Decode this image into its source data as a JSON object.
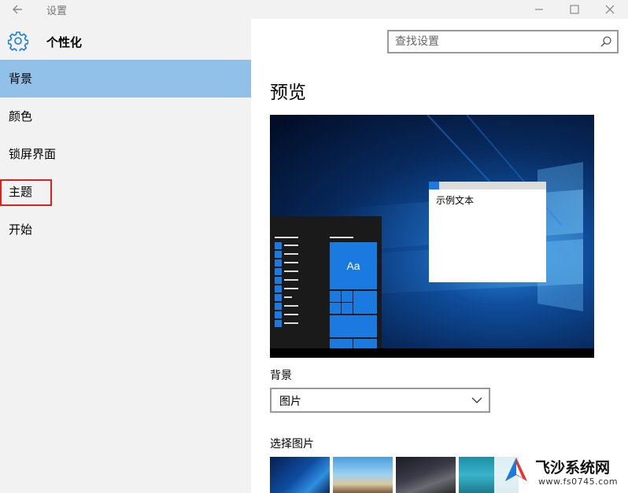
{
  "window": {
    "title": "设置",
    "back_icon": "back-arrow-icon",
    "controls": [
      "minimize-icon",
      "maximize-icon",
      "close-icon"
    ]
  },
  "header": {
    "icon": "gear-icon",
    "title": "个性化"
  },
  "search": {
    "placeholder": "查找设置",
    "icon": "search-icon"
  },
  "sidebar": {
    "items": [
      {
        "label": "背景",
        "active": true
      },
      {
        "label": "颜色"
      },
      {
        "label": "锁屏界面"
      },
      {
        "label": "主题",
        "highlighted": true
      },
      {
        "label": "开始"
      }
    ]
  },
  "main": {
    "preview_title": "预览",
    "preview": {
      "sample_text": "示例文本",
      "tile_text": "Aa"
    },
    "background_label": "背景",
    "background_value": "图片",
    "choose_picture_label": "选择图片"
  },
  "watermark": {
    "name": "飞沙系统网",
    "url": "www.fs0745.com"
  },
  "colors": {
    "accent": "#1a7ae0",
    "active_nav": "#91c1e8",
    "pane_bg": "#f2f2f2",
    "highlight_box": "#d9231d"
  }
}
